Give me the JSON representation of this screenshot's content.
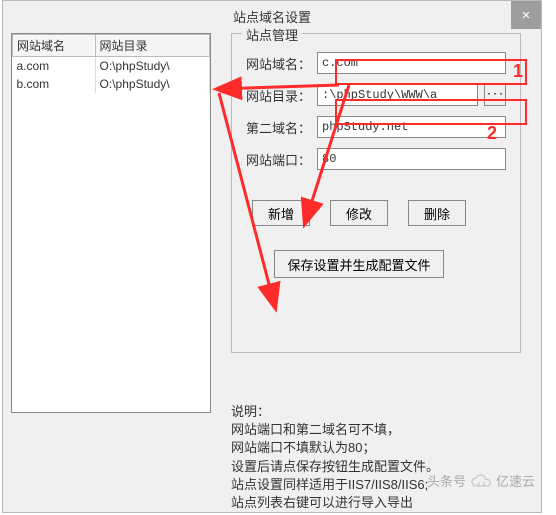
{
  "title": "站点域名设置",
  "close_glyph": "×",
  "table": {
    "headers": [
      "网站域名",
      "网站目录"
    ],
    "rows": [
      [
        "a.com",
        "O:\\phpStudy\\"
      ],
      [
        "b.com",
        "O:\\phpStudy\\"
      ]
    ]
  },
  "group": {
    "legend": "站点管理",
    "fields": {
      "domain_label": "网站域名：",
      "domain_value": "c.com",
      "dir_label": "网站目录：",
      "dir_value": ":\\phpStudy\\WWW\\a",
      "browse_label": "···",
      "second_label": "第二域名：",
      "second_value": "phpStudy.net",
      "port_label": "网站端口：",
      "port_value": "80"
    },
    "buttons": {
      "add": "新增",
      "modify": "修改",
      "delete": "删除",
      "save": "保存设置并生成配置文件"
    }
  },
  "notes": {
    "l1": "说明：",
    "l2": "网站端口和第二域名可不填，",
    "l3": "网站端口不填默认为80；",
    "l4": "设置后请点保存按钮生成配置文件。",
    "l5": "站点设置同样适用于IIS7/IIS8/IIS6;",
    "l6": "站点列表右键可以进行导入导出"
  },
  "annotations": {
    "one": "1",
    "two": "2"
  },
  "watermark": {
    "prefix": "头条号",
    "brand": "亿速云"
  }
}
